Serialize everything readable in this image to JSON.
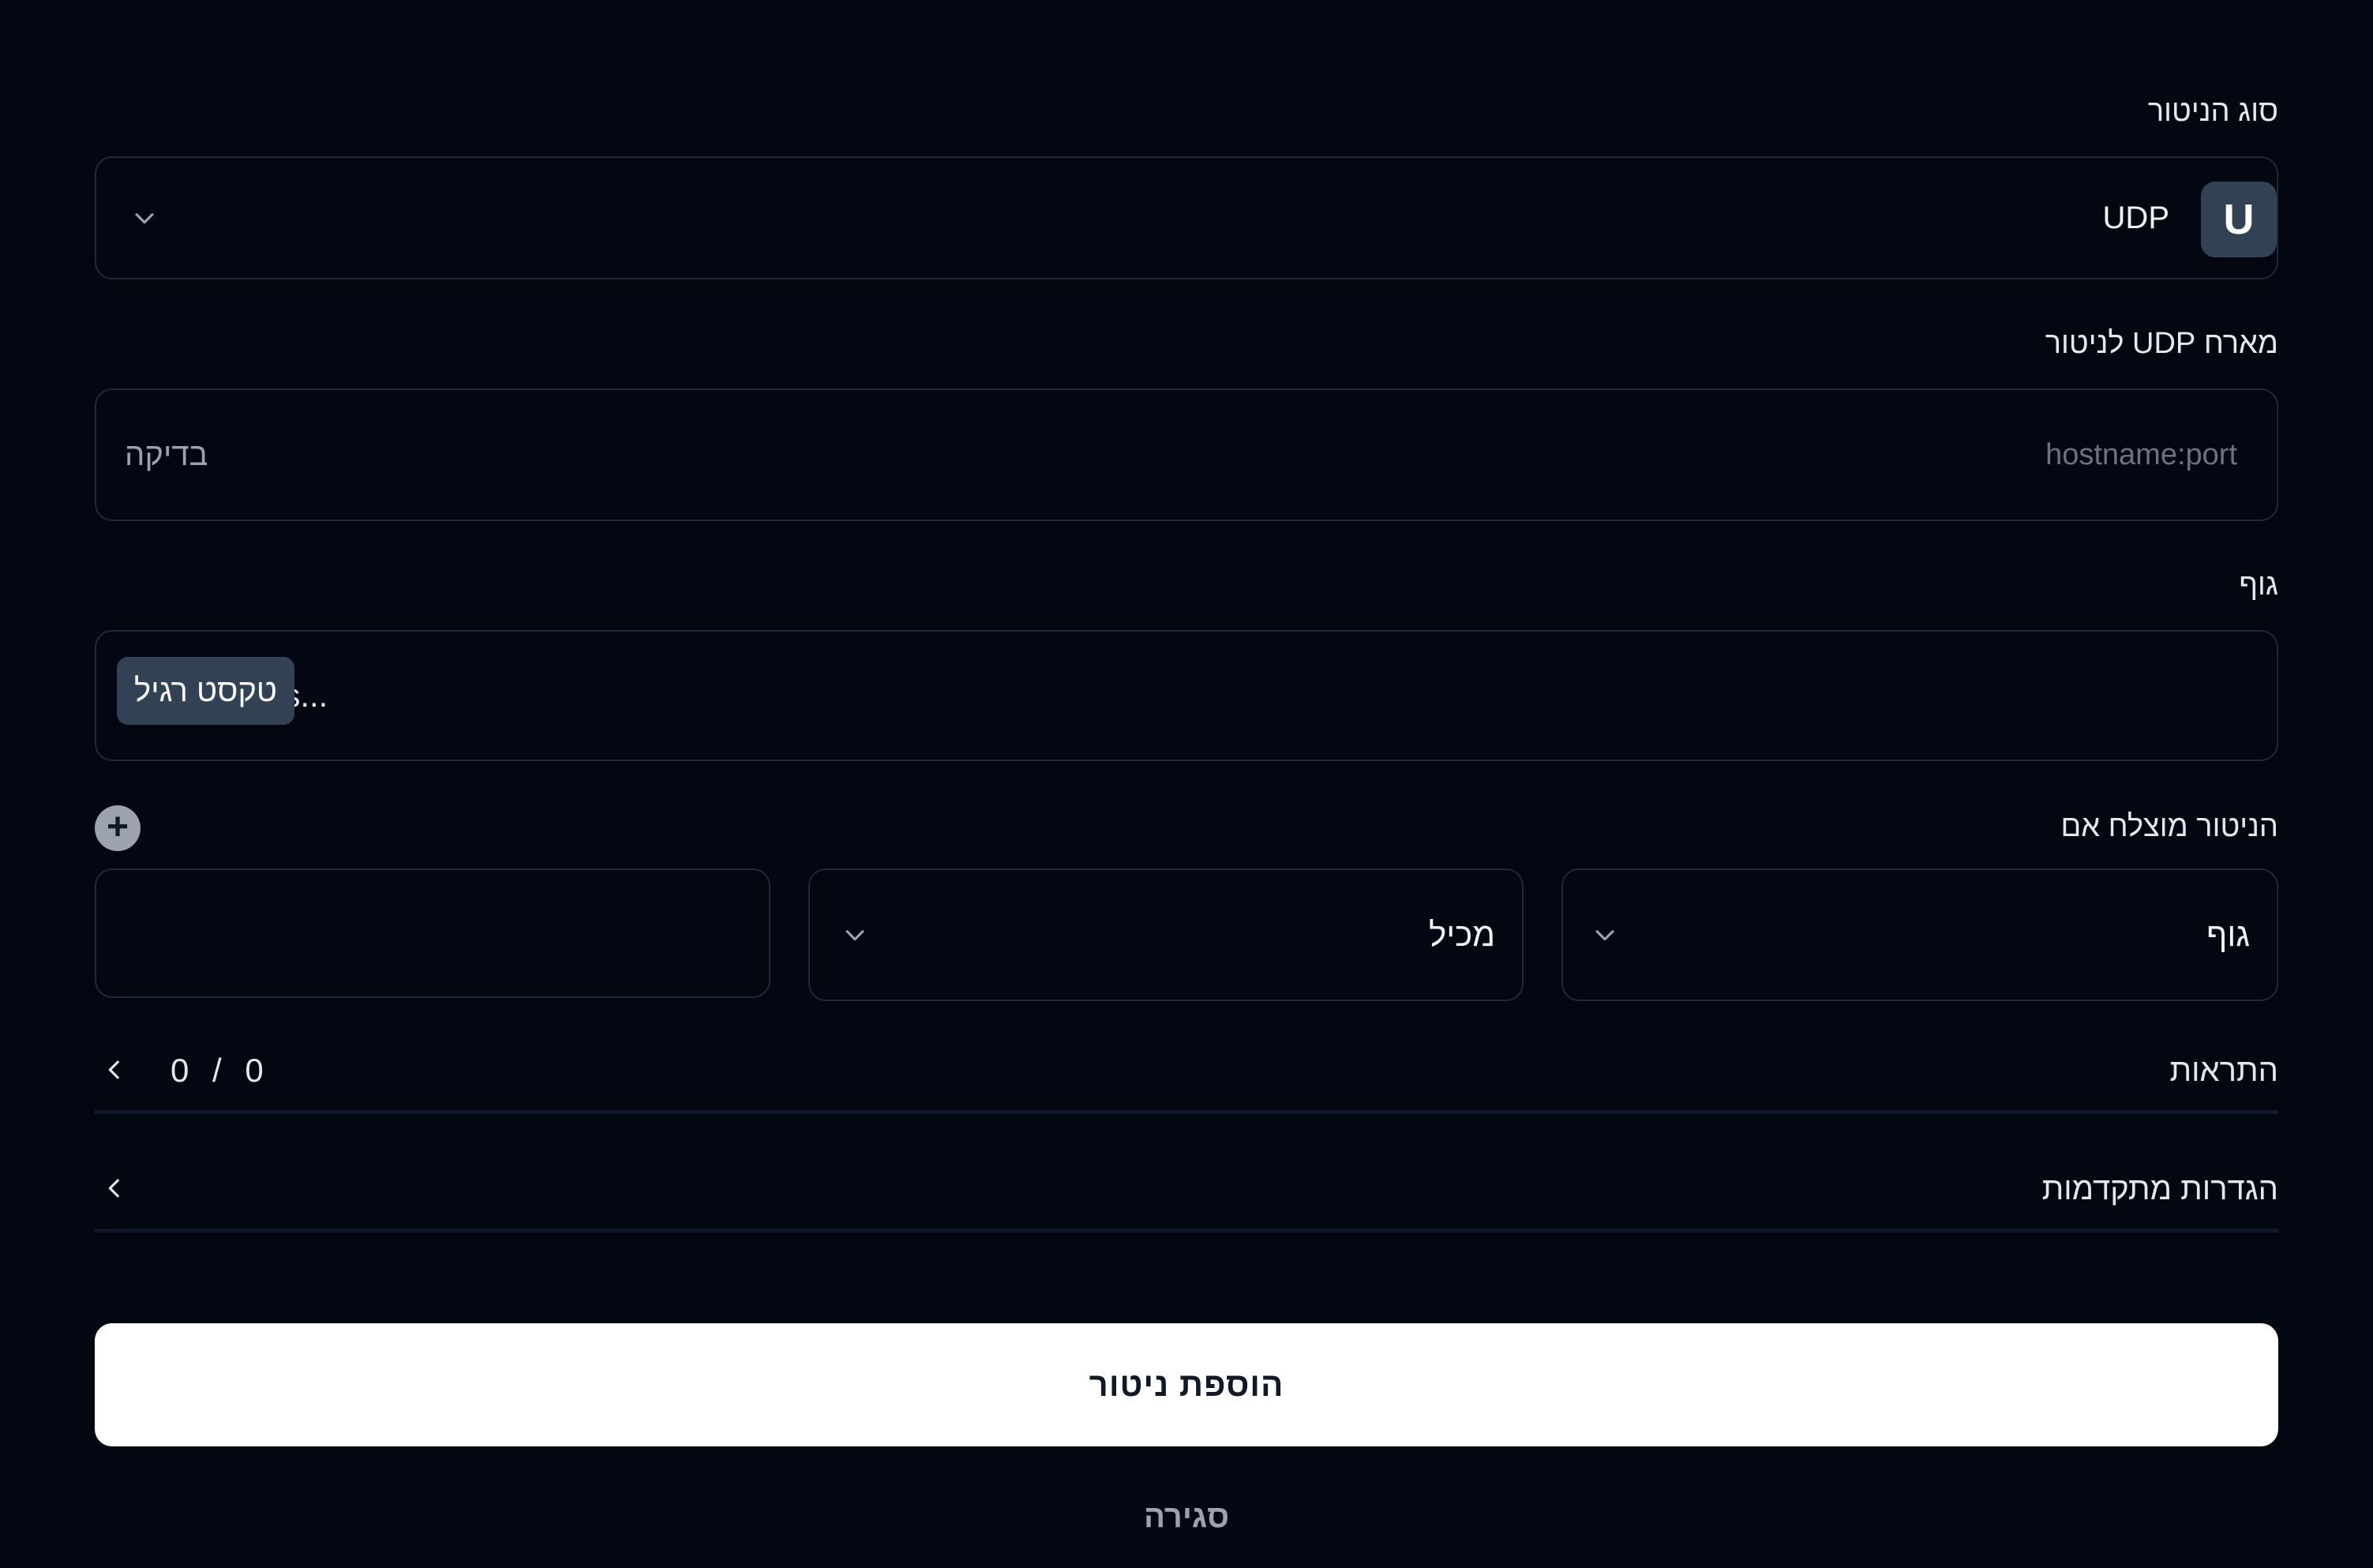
{
  "monitor_type": {
    "label": "סוג הניטור",
    "selected": "UDP",
    "badge_letter": "U",
    "badge_color": "#334155"
  },
  "host": {
    "label": "מארח UDP לניטור",
    "placeholder": "hostname:port",
    "test_button": "בדיקה"
  },
  "body": {
    "label": "גוף",
    "value": "ars...",
    "format_tooltip": "טקסט רגיל"
  },
  "success_condition": {
    "label": "הניטור מוצלח אם",
    "field": "גוף",
    "operator": "מכיל",
    "value": ""
  },
  "notifications": {
    "label": "התראות",
    "count": "0 / 0"
  },
  "advanced": {
    "label": "הגדרות מתקדמות"
  },
  "actions": {
    "submit": "הוספת ניטור",
    "close": "סגירה"
  }
}
